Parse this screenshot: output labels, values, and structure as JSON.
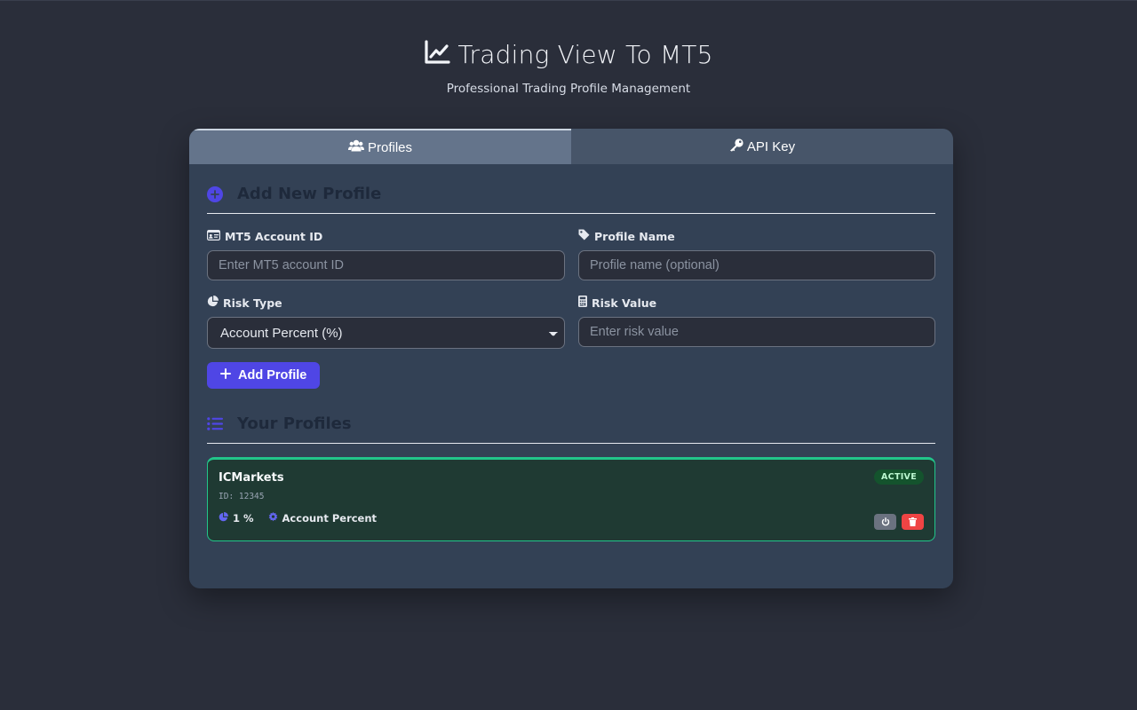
{
  "app": {
    "title": "Trading View To MT5",
    "subtitle": "Professional Trading Profile Management",
    "icon": "chart-line-icon"
  },
  "tabs": [
    {
      "label": "Profiles",
      "icon": "users-icon",
      "active": true
    },
    {
      "label": "API Key",
      "icon": "key-icon",
      "active": false
    }
  ],
  "add_section": {
    "title": "Add New Profile",
    "icon": "plus-circle-icon",
    "fields": {
      "account_id": {
        "label": "MT5 Account ID",
        "placeholder": "Enter MT5 account ID",
        "value": "",
        "icon": "id-card-icon"
      },
      "profile_name": {
        "label": "Profile Name",
        "placeholder": "Profile name (optional)",
        "value": "",
        "icon": "tag-icon"
      },
      "risk_type": {
        "label": "Risk Type",
        "selected": "Account Percent (%)",
        "icon": "pie-chart-icon"
      },
      "risk_value": {
        "label": "Risk Value",
        "placeholder": "Enter risk value",
        "value": "",
        "icon": "calculator-icon"
      }
    },
    "add_button": "Add Profile"
  },
  "profiles_section": {
    "title": "Your Profiles",
    "icon": "list-icon",
    "profiles": [
      {
        "name": "ICMarkets",
        "id_text": "ID: 12345",
        "risk_display": "1 %",
        "risk_type": "Account Percent",
        "status": "ACTIVE"
      }
    ]
  },
  "colors": {
    "background": "#2a2e3a",
    "panel": "#334155",
    "accent": "#4f46e5",
    "active_border": "#22c58a",
    "delete": "#ef4444"
  }
}
